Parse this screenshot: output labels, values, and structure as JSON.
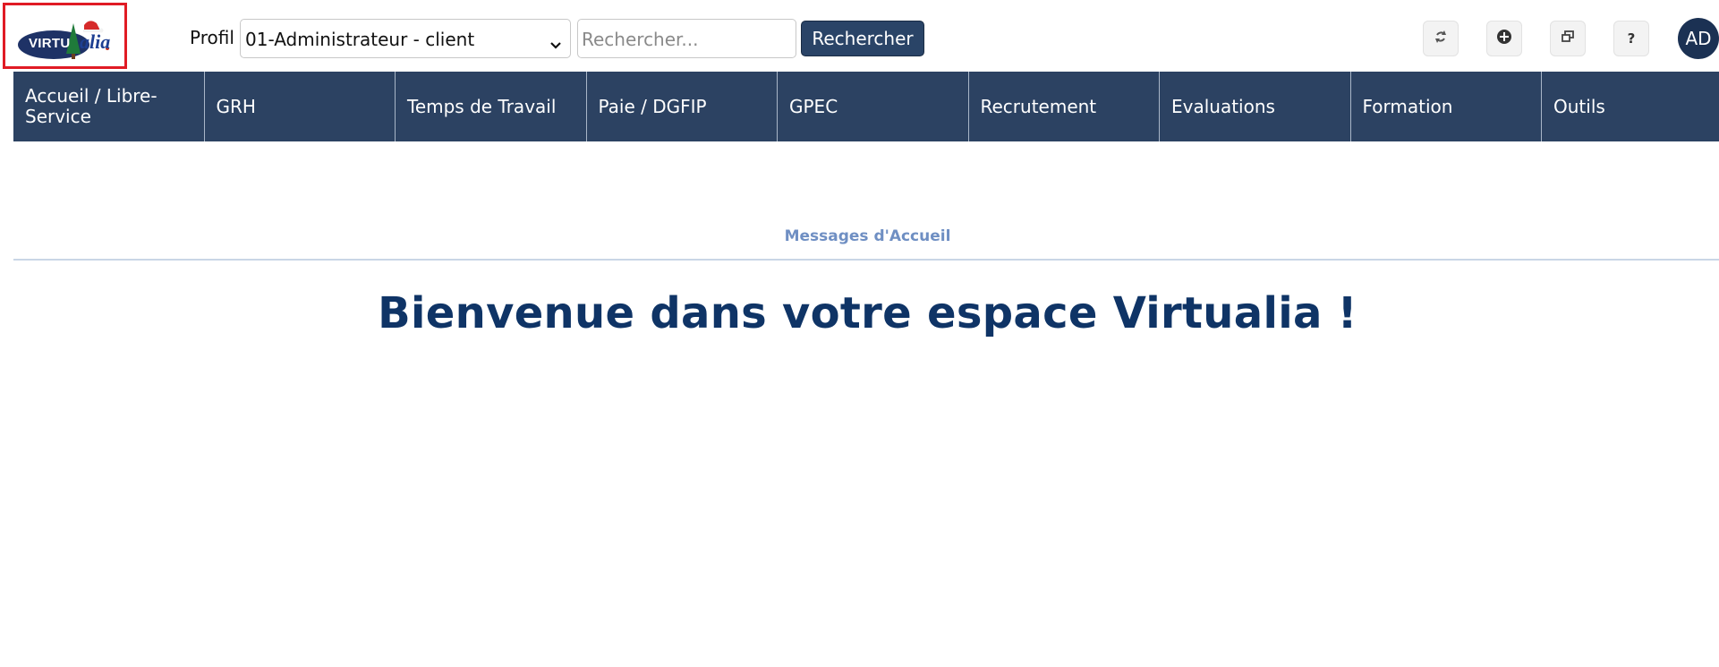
{
  "logo": {
    "text_part1": "VIRTU",
    "text_part2": "alia"
  },
  "header": {
    "profil_label": "Profil",
    "profil_value": "01-Administrateur - client",
    "search_placeholder": "Rechercher...",
    "search_button": "Rechercher",
    "tool_buttons": [
      {
        "icon": "refresh-icon"
      },
      {
        "icon": "plus-circle-icon"
      },
      {
        "icon": "new-window-icon"
      },
      {
        "icon": "help-icon",
        "glyph": "?"
      }
    ],
    "avatar_initials": "AD"
  },
  "nav": {
    "items": [
      {
        "label": "Accueil / Libre-Service"
      },
      {
        "label": "GRH"
      },
      {
        "label": "Temps de Travail"
      },
      {
        "label": "Paie / DGFIP"
      },
      {
        "label": "GPEC"
      },
      {
        "label": "Recrutement"
      },
      {
        "label": "Evaluations"
      },
      {
        "label": "Formation"
      },
      {
        "label": "Outils"
      }
    ]
  },
  "main": {
    "section_title": "Messages d'Accueil",
    "welcome": "Bienvenue dans votre espace Virtualia !"
  },
  "colors": {
    "nav_bg": "#2c4262",
    "button_bg": "#2a4467",
    "title": "#0f3466",
    "section": "#6f8fc3",
    "highlight": "#e01b24"
  }
}
